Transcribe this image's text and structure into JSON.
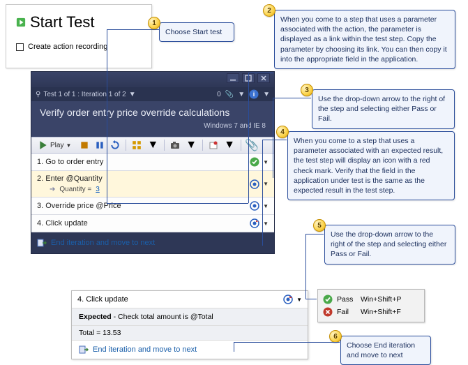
{
  "start": {
    "title": "Start Test",
    "checkbox": "Create action recording"
  },
  "mtm": {
    "tab": "Test 1 of 1 : Iteration 1 of 2",
    "title": "Verify order entry price override calculations",
    "config": "Windows 7 and IE 8",
    "play": "Play",
    "counter": "0",
    "steps": {
      "s1": "1. Go to order entry",
      "s2": "2. Enter @Quantity",
      "s2param_label": "Quantity = ",
      "s2param_value": "3",
      "s3": "3. Override price @Price",
      "s4": "4. Click update"
    },
    "end": "End iteration and move to next"
  },
  "detail": {
    "row": "4. Click update",
    "expected_prefix": "Expected",
    "expected_rest": " - Check total amount is @Total",
    "value": "Total = 13.53",
    "end": "End iteration and move to next"
  },
  "passfail": {
    "pass": "Pass",
    "pass_key": "Win+Shift+P",
    "fail": "Fail",
    "fail_key": "Win+Shift+F"
  },
  "callouts": {
    "c1": "Choose Start test",
    "c2": "When you come to a step that uses a parameter associated with the action, the parameter is displayed as a link within the test step. Copy the parameter by choosing its link. You can then copy it into the appropriate field in the application.",
    "c3": "Use the drop-down arrow to the right of the step and selecting either Pass or Fail.",
    "c4": "When you come to a step that uses a parameter associated with an expected result, the test step will display an icon with a red check mark. Verify that the field in the application under test is the same as the expected result in the test step.",
    "c5": "Use the drop-down arrow to the right of the step and selecting either Pass or Fail.",
    "c6": "Choose End iteration and move to next"
  },
  "nums": {
    "n1": "1",
    "n2": "2",
    "n3": "3",
    "n4": "4",
    "n5": "5",
    "n6": "6"
  }
}
